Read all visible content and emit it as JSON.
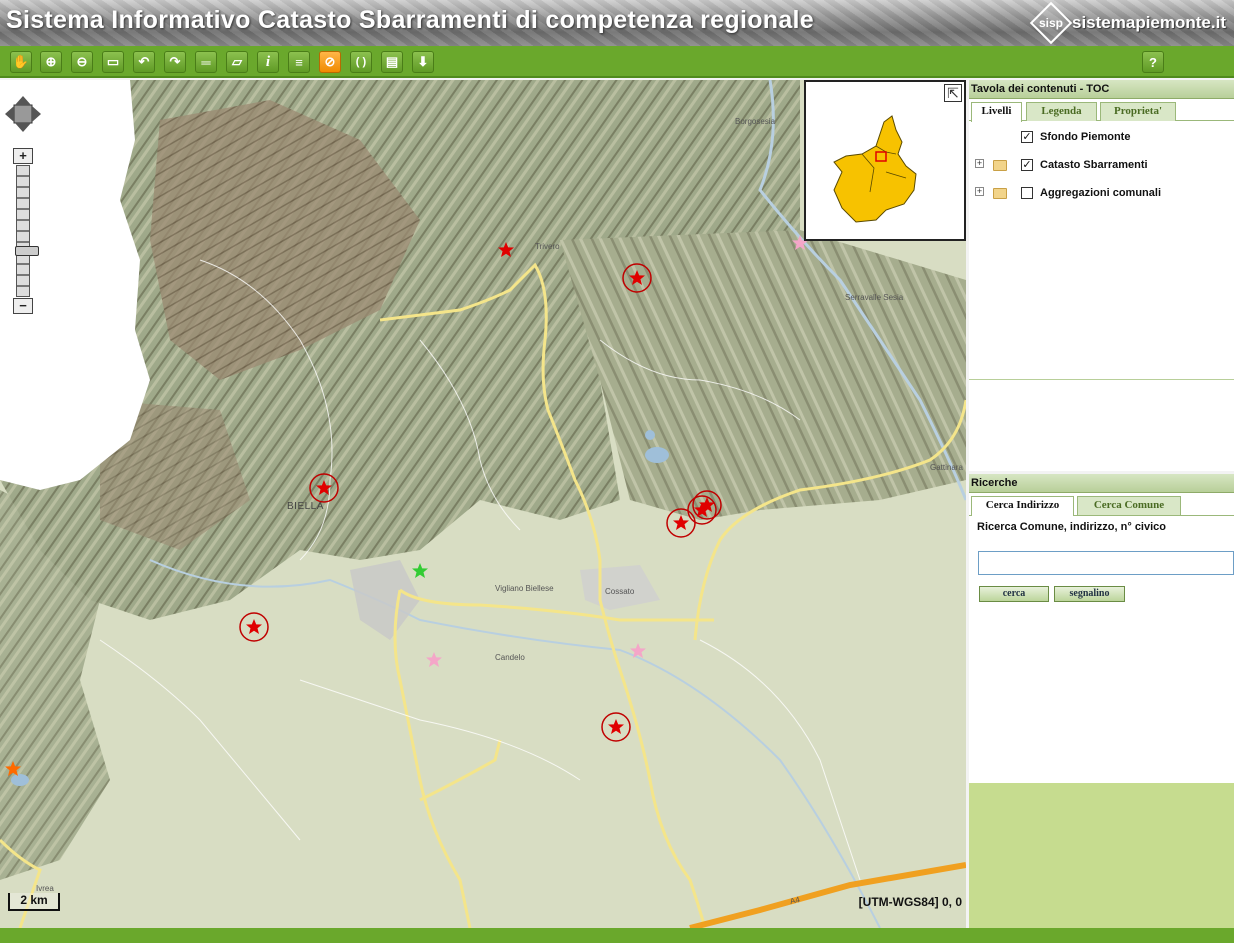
{
  "header": {
    "title": "Sistema Informativo Catasto Sbarramenti di competenza regionale",
    "logo_mark": "sisp",
    "logo_site": "sistemapiemonte.it"
  },
  "toolbar": {
    "tools": [
      {
        "name": "pan-tool",
        "icon": "hand-icon",
        "glyph": "✋"
      },
      {
        "name": "zoom-in-tool",
        "icon": "zoom-in-icon",
        "glyph": "⊕"
      },
      {
        "name": "zoom-out-tool",
        "icon": "zoom-out-icon",
        "glyph": "⊖"
      },
      {
        "name": "zoom-box-tool",
        "icon": "zoom-box-icon",
        "glyph": "▭"
      },
      {
        "name": "previous-view-tool",
        "icon": "previous-view-icon",
        "glyph": "↶"
      },
      {
        "name": "next-view-tool",
        "icon": "next-view-icon",
        "glyph": "↷"
      },
      {
        "name": "measure-distance-tool",
        "icon": "ruler-icon",
        "glyph": "═"
      },
      {
        "name": "measure-area-tool",
        "icon": "area-icon",
        "glyph": "▱"
      },
      {
        "name": "info-tool",
        "icon": "info-icon",
        "glyph": "i"
      },
      {
        "name": "info-layer-tool",
        "icon": "info-layer-icon",
        "glyph": "≡"
      },
      {
        "name": "no-select-tool",
        "icon": "forbidden-icon",
        "glyph": "⊘"
      },
      {
        "name": "refresh-tool",
        "icon": "refresh-icon",
        "glyph": "( )"
      },
      {
        "name": "print-tool",
        "icon": "printer-icon",
        "glyph": "▤"
      },
      {
        "name": "download-tool",
        "icon": "download-icon",
        "glyph": "⬇"
      }
    ],
    "help_glyph": "?"
  },
  "map": {
    "labels": {
      "borgosesia": "Borgosesia",
      "trivero": "Trivero",
      "serravalle": "Serravalle Sesia",
      "gattinara": "Gattinara",
      "biella": "BIELLA",
      "vigliano": "Vigliano Biellese",
      "cossato": "Cossato",
      "candelo": "Candelo",
      "ivrea": "Ivrea",
      "a4": "A4"
    },
    "scale": "2 km",
    "coordinates": "[UTM-WGS84] 0, 0",
    "zoom_plus": "+",
    "zoom_minus": "−",
    "overview_expand": "⇱",
    "colors": {
      "dam_marker": "#e00000",
      "dam_ring": "#c00000",
      "pink_marker": "#f4a6c8",
      "green_marker": "#33cc33",
      "orange_marker": "#ff6a00",
      "road": "#f4e58a",
      "motorway": "#f0a020",
      "overview_region": "#f7c200"
    }
  },
  "toc": {
    "title": "Tavola dei contenuti - TOC",
    "tabs": [
      "Livelli",
      "Legenda",
      "Proprieta'"
    ],
    "active_tab": 0,
    "layers": [
      {
        "label": "Sfondo Piemonte",
        "checked": "✓",
        "folder": false
      },
      {
        "label": "Catasto Sbarramenti",
        "checked": "✓",
        "folder": true
      },
      {
        "label": "Aggregazioni comunali",
        "checked": "",
        "folder": true
      }
    ],
    "expander_glyph": "+"
  },
  "search": {
    "title": "Ricerche",
    "tabs": [
      "Cerca Indirizzo",
      "Cerca Comune"
    ],
    "active_tab": 0,
    "label": "Ricerca Comune, indirizzo, n° civico",
    "input_value": "",
    "input_placeholder": "",
    "buttons": {
      "search": "cerca",
      "report": "segnalino"
    }
  }
}
